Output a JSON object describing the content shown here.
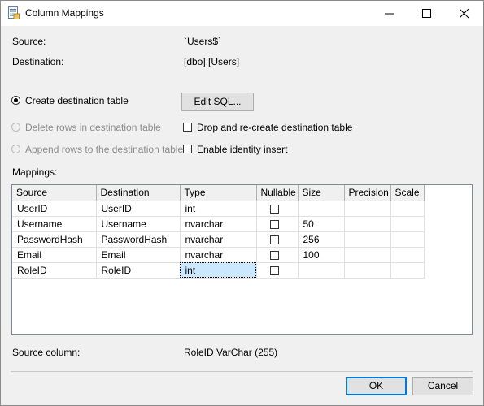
{
  "window": {
    "title": "Column Mappings"
  },
  "source": {
    "label": "Source:",
    "value": "`Users$`"
  },
  "destination": {
    "label": "Destination:",
    "value": "[dbo].[Users]"
  },
  "options": {
    "create_table": "Create destination table",
    "delete_rows": "Delete rows in destination table",
    "append_rows": "Append rows to the destination table",
    "edit_sql": "Edit SQL...",
    "drop_recreate": "Drop and re-create destination table",
    "enable_identity": "Enable identity insert"
  },
  "mappings": {
    "label": "Mappings:",
    "columns": [
      "Source",
      "Destination",
      "Type",
      "Nullable",
      "Size",
      "Precision",
      "Scale"
    ],
    "rows": [
      {
        "source": "UserID",
        "destination": "UserID",
        "type": "int",
        "size": "",
        "precision": "",
        "scale": ""
      },
      {
        "source": "Username",
        "destination": "Username",
        "type": "nvarchar",
        "size": "50",
        "precision": "",
        "scale": ""
      },
      {
        "source": "PasswordHash",
        "destination": "PasswordHash",
        "type": "nvarchar",
        "size": "256",
        "precision": "",
        "scale": ""
      },
      {
        "source": "Email",
        "destination": "Email",
        "type": "nvarchar",
        "size": "100",
        "precision": "",
        "scale": ""
      },
      {
        "source": "RoleID",
        "destination": "RoleID",
        "type": "int",
        "size": "",
        "precision": "",
        "scale": ""
      }
    ]
  },
  "source_column": {
    "label": "Source column:",
    "value": "RoleID VarChar (255)"
  },
  "buttons": {
    "ok": "OK",
    "cancel": "Cancel"
  },
  "colors": {
    "selection": "#cce8ff",
    "accent": "#0078d7"
  }
}
